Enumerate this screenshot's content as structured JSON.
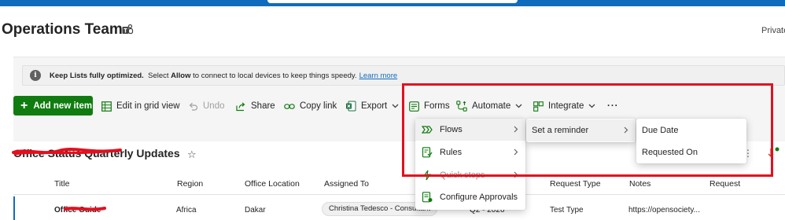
{
  "site": {
    "title": "Operations Team",
    "privacy": "Private"
  },
  "banner": {
    "bold_text": "Keep Lists fully optimized.",
    "text_pre": "Select",
    "text_bold": "Allow",
    "text_post": "to connect to local devices to keep things speedy.",
    "link": "Learn more"
  },
  "toolbar": {
    "new_item": "Add new item",
    "grid_view": "Edit in grid view",
    "undo": "Undo",
    "share": "Share",
    "copy_link": "Copy link",
    "export": "Export",
    "forms": "Forms",
    "automate": "Automate",
    "integrate": "Integrate",
    "more": "···"
  },
  "list": {
    "title": "Office Status Quarterly Updates",
    "columns": [
      "Title",
      "Region",
      "Office Location",
      "Assigned To",
      "Request Type",
      "Notes",
      "Request"
    ],
    "row": {
      "title": "Office Guide",
      "region": "Africa",
      "office_location": "Dakar",
      "assigned_to": "Christina Tedesco - Consultant",
      "quarter": "Q2 - 2026",
      "request_type": "Test Type",
      "notes": "https://opensociety..."
    }
  },
  "automate_menu": {
    "items": [
      {
        "label": "Flows",
        "icon": "flow-icon",
        "submenu": true
      },
      {
        "label": "Rules",
        "icon": "rules-icon",
        "submenu": true
      },
      {
        "label": "Quick steps",
        "icon": "quick-steps-icon",
        "submenu": true
      },
      {
        "label": "Configure Approvals",
        "icon": "approvals-icon",
        "submenu": false
      }
    ]
  },
  "flows_menu": {
    "items": [
      {
        "label": "Set a reminder",
        "submenu": true
      }
    ]
  },
  "reminder_menu": {
    "items": [
      {
        "label": "Due Date"
      },
      {
        "label": "Requested On"
      }
    ]
  },
  "colors": {
    "accent": "#0f6cbd",
    "new_button": "#107c10",
    "highlight_box": "#e3101f",
    "redaction": "#e3101f"
  }
}
